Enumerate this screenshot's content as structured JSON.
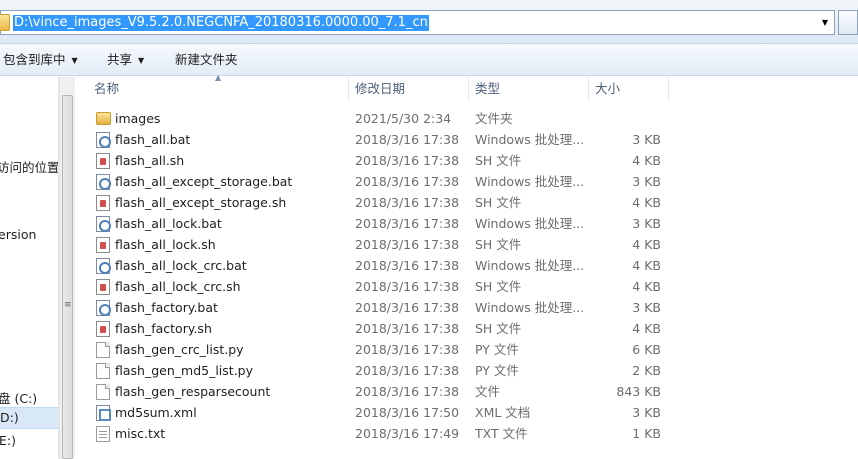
{
  "address": {
    "path": "D:\\vince_images_V9.5.2.0.NEGCNFA_20180316.0000.00_7.1_cn"
  },
  "toolbar": {
    "include_library": "包含到库中",
    "share": "共享",
    "new_folder": "新建文件夹"
  },
  "nav": {
    "items": [
      "访问的位置",
      "ersion",
      "盘 (C:)",
      "D:)",
      "E:)"
    ]
  },
  "columns": {
    "name": "名称",
    "date": "修改日期",
    "type": "类型",
    "size": "大小"
  },
  "files": [
    {
      "name": "images",
      "date": "2021/5/30 2:34",
      "type": "文件夹",
      "size": "",
      "icon": "folder-icon"
    },
    {
      "name": "flash_all.bat",
      "date": "2018/3/16 17:38",
      "type": "Windows 批处理...",
      "size": "3 KB",
      "icon": "bat-file-icon"
    },
    {
      "name": "flash_all.sh",
      "date": "2018/3/16 17:38",
      "type": "SH 文件",
      "size": "4 KB",
      "icon": "sh-file-icon"
    },
    {
      "name": "flash_all_except_storage.bat",
      "date": "2018/3/16 17:38",
      "type": "Windows 批处理...",
      "size": "3 KB",
      "icon": "bat-file-icon"
    },
    {
      "name": "flash_all_except_storage.sh",
      "date": "2018/3/16 17:38",
      "type": "SH 文件",
      "size": "4 KB",
      "icon": "sh-file-icon"
    },
    {
      "name": "flash_all_lock.bat",
      "date": "2018/3/16 17:38",
      "type": "Windows 批处理...",
      "size": "3 KB",
      "icon": "bat-file-icon"
    },
    {
      "name": "flash_all_lock.sh",
      "date": "2018/3/16 17:38",
      "type": "SH 文件",
      "size": "4 KB",
      "icon": "sh-file-icon"
    },
    {
      "name": "flash_all_lock_crc.bat",
      "date": "2018/3/16 17:38",
      "type": "Windows 批处理...",
      "size": "4 KB",
      "icon": "bat-file-icon"
    },
    {
      "name": "flash_all_lock_crc.sh",
      "date": "2018/3/16 17:38",
      "type": "SH 文件",
      "size": "4 KB",
      "icon": "sh-file-icon"
    },
    {
      "name": "flash_factory.bat",
      "date": "2018/3/16 17:38",
      "type": "Windows 批处理...",
      "size": "3 KB",
      "icon": "bat-file-icon"
    },
    {
      "name": "flash_factory.sh",
      "date": "2018/3/16 17:38",
      "type": "SH 文件",
      "size": "4 KB",
      "icon": "sh-file-icon"
    },
    {
      "name": "flash_gen_crc_list.py",
      "date": "2018/3/16 17:38",
      "type": "PY 文件",
      "size": "6 KB",
      "icon": "py-file-icon"
    },
    {
      "name": "flash_gen_md5_list.py",
      "date": "2018/3/16 17:38",
      "type": "PY 文件",
      "size": "2 KB",
      "icon": "py-file-icon"
    },
    {
      "name": "flash_gen_resparsecount",
      "date": "2018/3/16 17:38",
      "type": "文件",
      "size": "843 KB",
      "icon": "generic-file-icon"
    },
    {
      "name": "md5sum.xml",
      "date": "2018/3/16 17:50",
      "type": "XML 文档",
      "size": "3 KB",
      "icon": "xml-file-icon"
    },
    {
      "name": "misc.txt",
      "date": "2018/3/16 17:49",
      "type": "TXT 文件",
      "size": "1 KB",
      "icon": "txt-file-icon"
    }
  ],
  "colors": {
    "selection": "#3399ff",
    "nav_selected": "#d9e8f7",
    "header_text": "#4c607a"
  }
}
